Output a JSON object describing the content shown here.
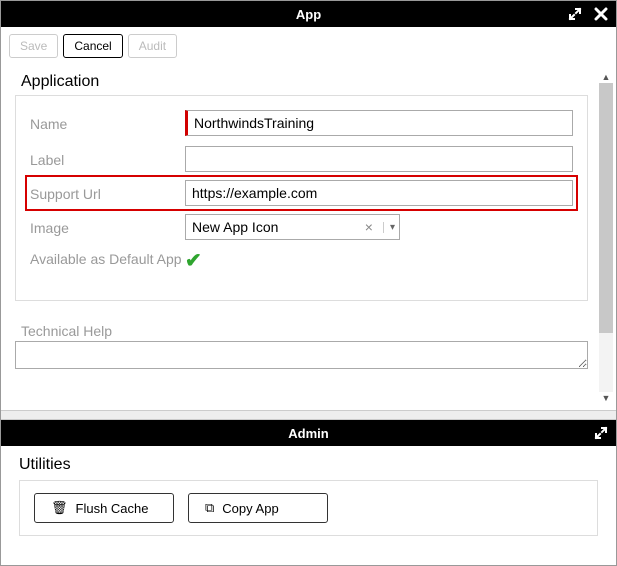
{
  "header": {
    "title": "App"
  },
  "toolbar": {
    "save": "Save",
    "cancel": "Cancel",
    "audit": "Audit"
  },
  "application": {
    "section_title": "Application",
    "fields": {
      "name": {
        "label": "Name",
        "value": "NorthwindsTraining"
      },
      "label": {
        "label": "Label",
        "value": ""
      },
      "support_url": {
        "label": "Support Url",
        "value": "https://example.com"
      },
      "image": {
        "label": "Image",
        "value": "New App Icon"
      },
      "default_app": {
        "label": "Available as Default App",
        "checked": true
      }
    },
    "technical_help": {
      "label": "Technical Help",
      "value": ""
    }
  },
  "admin": {
    "title": "Admin",
    "utilities_title": "Utilities",
    "flush_cache": "Flush Cache",
    "copy_app": "Copy App"
  }
}
